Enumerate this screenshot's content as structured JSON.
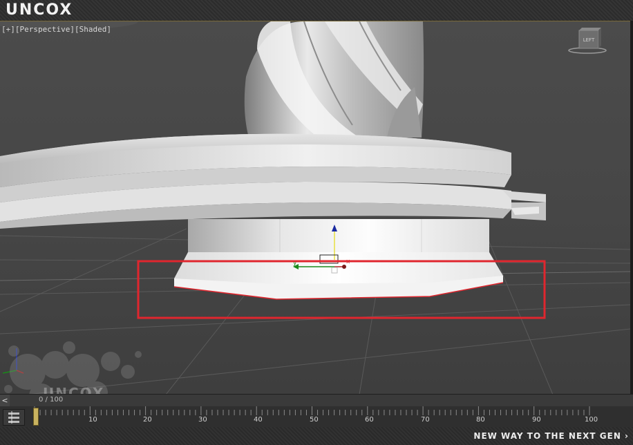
{
  "brand": {
    "logo_text": "UNCOX"
  },
  "viewport": {
    "label_plus": "[+]",
    "label_view": "[Perspective]",
    "label_shading": "[Shaded]",
    "viewcube_face": "LEFT",
    "gizmo": {
      "x_label": "x",
      "y_label": "y"
    }
  },
  "timeline": {
    "frame_text": "0 / 100",
    "ticks": [
      "0",
      "10",
      "20",
      "30",
      "40",
      "50",
      "60",
      "70",
      "80",
      "90",
      "100"
    ]
  },
  "watermark": {
    "text": "UNCOX"
  },
  "footer": {
    "slogan": "NEW WAY TO THE NEXT GEN ›"
  },
  "colors": {
    "selection_box": "#e0262e",
    "viewport_border": "#8a7a4a"
  }
}
